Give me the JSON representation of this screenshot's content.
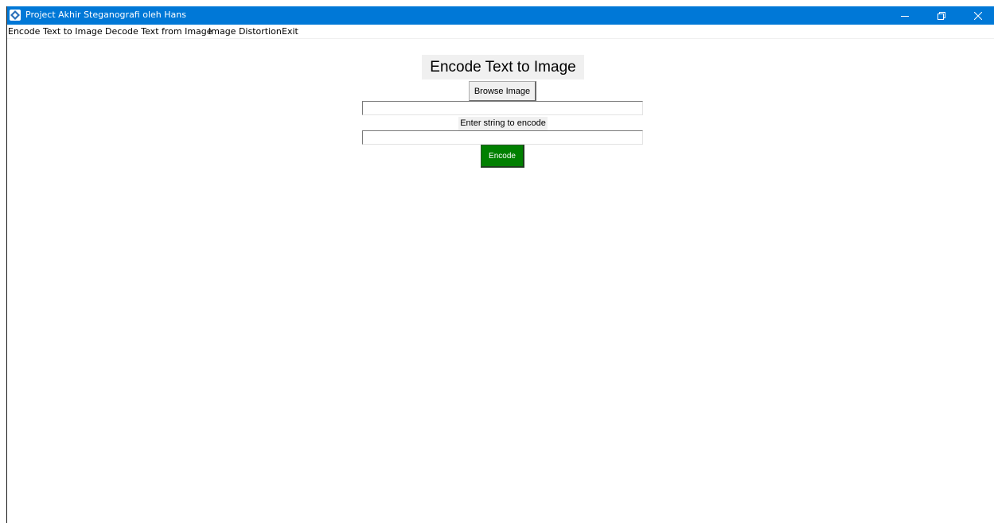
{
  "window": {
    "title": "Project Akhir Steganografi oleh Hans",
    "controls": {
      "minimize_icon": "minimize-icon",
      "maximize_icon": "restore-icon",
      "close_icon": "close-icon"
    }
  },
  "menu": {
    "items": [
      {
        "label": "Encode Text to Image"
      },
      {
        "label": "Decode Text from Image"
      },
      {
        "label": "Image Distortion"
      },
      {
        "label": "Exit"
      }
    ]
  },
  "main": {
    "heading": "Encode Text to Image",
    "browse_button": "Browse Image",
    "image_path_value": "",
    "string_label": "Enter string to encode",
    "string_value": "",
    "encode_button": "Encode"
  },
  "colors": {
    "titlebar": "#0078d7",
    "encode_button": "#008000",
    "label_background": "#f0f0f0"
  }
}
